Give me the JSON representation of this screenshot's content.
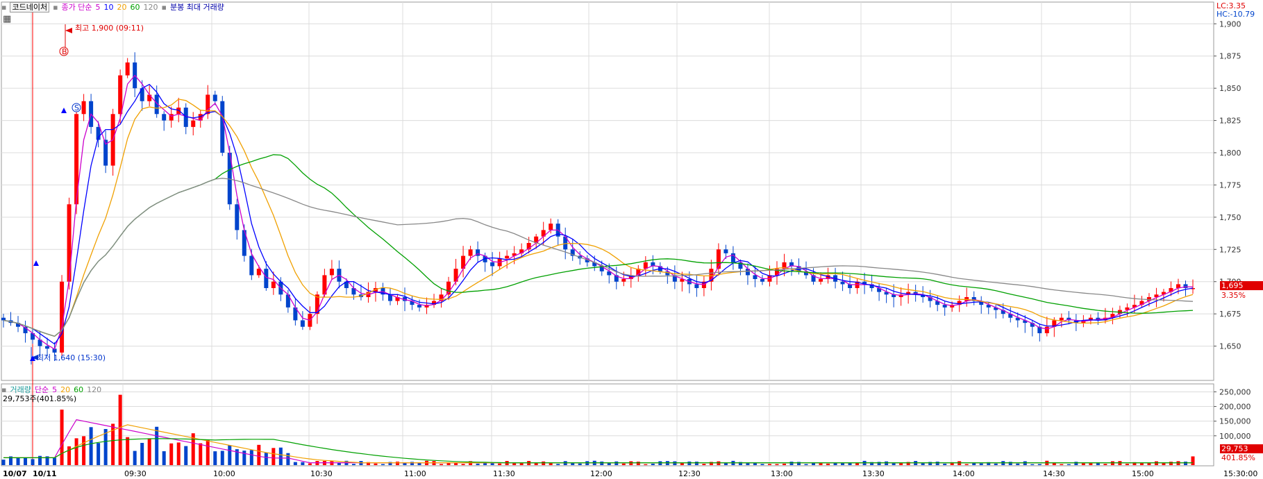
{
  "toolbar": {
    "stock_name": "코드네이처",
    "price_legend": {
      "label": "종가 단순",
      "periods": [
        "5",
        "10",
        "20",
        "60",
        "120"
      ]
    },
    "extra_legend": "분봉 최대 거래량"
  },
  "volume_legend": {
    "label": "거래량",
    "ma_label": "단순",
    "periods": [
      "5",
      "20",
      "60",
      "120"
    ]
  },
  "volume_summary": "29,753주(401.85%)",
  "right_info": {
    "lc": "LC:3.35",
    "hc": "HC:-10.79"
  },
  "price_tag": {
    "value": "1,695",
    "pct": "3.35%"
  },
  "volume_tag": {
    "value": "29,753",
    "pct": "401.85%"
  },
  "annotations": {
    "high": "최고 1,900 (09:11)",
    "low": "최저 1,640 (15:30)",
    "buy_marker": "B",
    "sell_marker": "S"
  },
  "colors": {
    "up": "#ff0000",
    "down": "#0044cc",
    "ma5": "#cc00cc",
    "ma10": "#0000ff",
    "ma20": "#f0a000",
    "ma60": "#00a000",
    "ma120": "#888888",
    "grid": "#dcdcdc"
  },
  "chart_data": [
    {
      "type": "candlestick",
      "title": "",
      "x_ticks": [
        "10/07",
        "10/11",
        "09:30",
        "10:00",
        "10:30",
        "11:00",
        "11:30",
        "12:00",
        "12:30",
        "13:00",
        "13:30",
        "14:00",
        "14:30",
        "15:00",
        "15:30:00"
      ],
      "y_ticks": [
        "1,650",
        "1,675",
        "1,700",
        "1,725",
        "1,750",
        "1,775",
        "1,800",
        "1,825",
        "1,850",
        "1,875",
        "1,900"
      ],
      "ylim": [
        1625,
        1905
      ],
      "close_series": [
        1670,
        1668,
        1665,
        1660,
        1655,
        1650,
        1648,
        1645,
        1700,
        1760,
        1830,
        1840,
        1820,
        1810,
        1790,
        1830,
        1860,
        1870,
        1850,
        1840,
        1845,
        1830,
        1825,
        1830,
        1835,
        1820,
        1825,
        1830,
        1845,
        1840,
        1800,
        1760,
        1740,
        1720,
        1705,
        1710,
        1695,
        1700,
        1690,
        1680,
        1670,
        1665,
        1675,
        1690,
        1705,
        1710,
        1700,
        1695,
        1690,
        1688,
        1692,
        1695,
        1690,
        1685,
        1688,
        1685,
        1682,
        1680,
        1682,
        1685,
        1690,
        1700,
        1710,
        1720,
        1725,
        1720,
        1715,
        1712,
        1718,
        1720,
        1722,
        1725,
        1730,
        1735,
        1740,
        1745,
        1735,
        1725,
        1720,
        1718,
        1715,
        1712,
        1708,
        1705,
        1700,
        1702,
        1705,
        1710,
        1715,
        1712,
        1708,
        1705,
        1700,
        1702,
        1698,
        1695,
        1700,
        1710,
        1725,
        1722,
        1715,
        1710,
        1705,
        1702,
        1700,
        1705,
        1710,
        1715,
        1712,
        1708,
        1705,
        1700,
        1702,
        1705,
        1700,
        1698,
        1695,
        1700,
        1698,
        1695,
        1692,
        1690,
        1688,
        1690,
        1692,
        1690,
        1688,
        1685,
        1682,
        1680,
        1682,
        1685,
        1688,
        1685,
        1682,
        1680,
        1678,
        1675,
        1672,
        1670,
        1668,
        1665,
        1660,
        1665,
        1670,
        1672,
        1670,
        1668,
        1670,
        1672,
        1670,
        1672,
        1675,
        1678,
        1680,
        1682,
        1685,
        1688,
        1690,
        1692,
        1695,
        1698,
        1695,
        1695
      ]
    },
    {
      "type": "bar",
      "title": "",
      "y_ticks": [
        "100,000",
        "150,000",
        "200,000",
        "250,000"
      ],
      "ylim": [
        0,
        270000
      ]
    }
  ]
}
